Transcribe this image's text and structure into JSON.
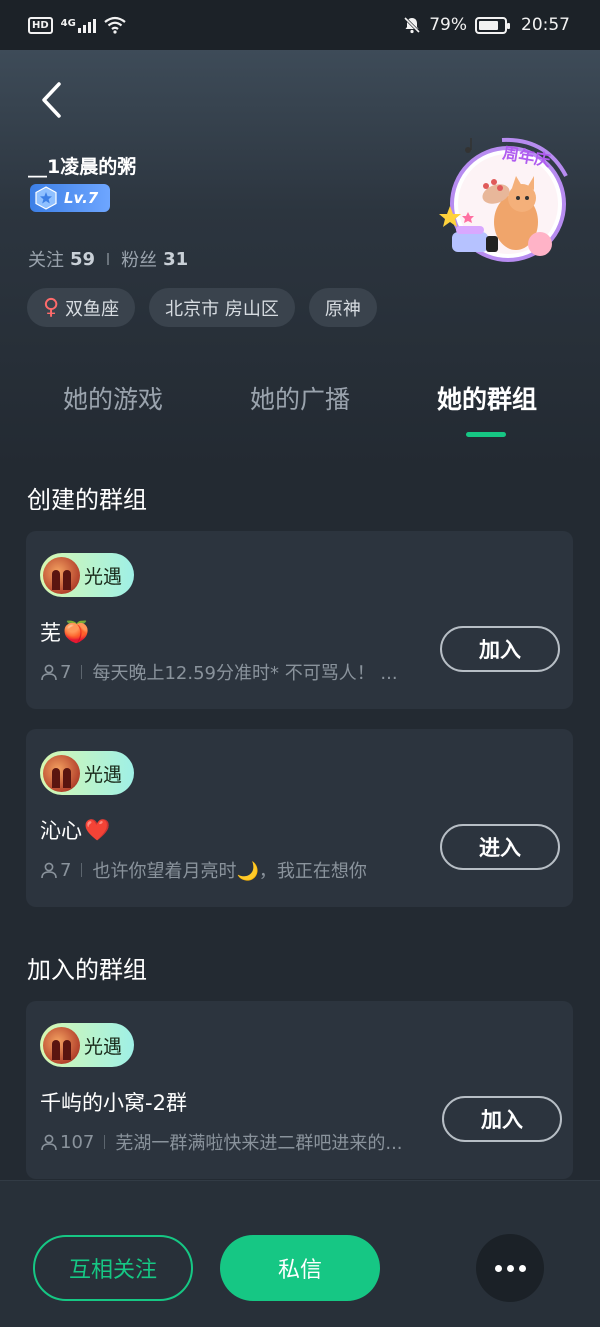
{
  "status_bar": {
    "network_label": "HD",
    "signal_type": "4G",
    "battery_percent": "79%",
    "battery_level": 0.79,
    "time": "20:57"
  },
  "profile": {
    "username": "__1凌晨的粥",
    "level": "Lv.7",
    "follow_label": "关注",
    "follow_count": "59",
    "fans_label": "粉丝",
    "fans_count": "31",
    "tags": [
      "双鱼座",
      "北京市 房山区",
      "原神"
    ],
    "avatar_frame_text": "周年庆"
  },
  "tabs": [
    {
      "label": "她的游戏",
      "active": false
    },
    {
      "label": "她的广播",
      "active": false
    },
    {
      "label": "她的群组",
      "active": true
    }
  ],
  "sections": {
    "created_title": "创建的群组",
    "joined_title": "加入的群组"
  },
  "groups": [
    {
      "game": "光遇",
      "name": "芜",
      "emoji": "🍑",
      "members": "7",
      "desc": "每天晚上12.59分准时* 不可骂人！ ...",
      "button": "加入"
    },
    {
      "game": "光遇",
      "name": "沁心",
      "emoji": "❤️",
      "members": "7",
      "desc": "也许你望着月亮时🌙，我正在想你",
      "button": "进入"
    },
    {
      "game": "光遇",
      "name": "千屿的小窝-2群",
      "emoji": "",
      "members": "107",
      "desc": "芜湖一群满啦快来进二群吧进来的...",
      "button": "加入"
    }
  ],
  "bottom_bar": {
    "mutual_follow": "互相关注",
    "message": "私信"
  },
  "colors": {
    "accent": "#16c784",
    "background": "#232a32",
    "card": "#2c343e"
  },
  "icons": [
    "back-arrow-icon",
    "person-icon",
    "more-dots-icon",
    "venus-icon",
    "level-hex-icon"
  ]
}
